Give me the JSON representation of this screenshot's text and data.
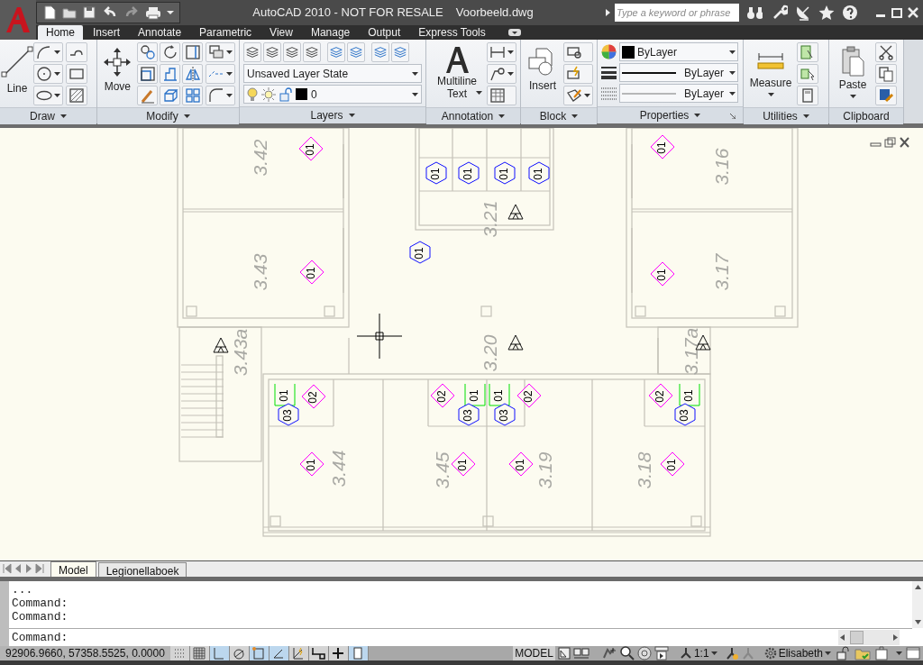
{
  "title_bar": {
    "title": "AutoCAD 2010 - NOT FOR RESALE",
    "document": "Voorbeeld.dwg",
    "search": {
      "placeholder": "Type a keyword or phrase"
    }
  },
  "ribbon_tabs": [
    {
      "label": "Home",
      "selected": true
    },
    {
      "label": "Insert",
      "selected": false
    },
    {
      "label": "Annotate",
      "selected": false
    },
    {
      "label": "Parametric",
      "selected": false
    },
    {
      "label": "View",
      "selected": false
    },
    {
      "label": "Manage",
      "selected": false
    },
    {
      "label": "Output",
      "selected": false
    },
    {
      "label": "Express Tools",
      "selected": false
    }
  ],
  "ribbon_panels": {
    "draw": {
      "title": "Draw",
      "big_button": "Line"
    },
    "modify": {
      "title": "Modify",
      "big_button": "Move"
    },
    "layers": {
      "title": "Layers",
      "layer_state": "Unsaved Layer State",
      "current_layer": "0"
    },
    "annotation": {
      "title": "Annotation",
      "big_button": [
        "Multiline",
        "Text"
      ]
    },
    "block": {
      "title": "Block",
      "big_button": "Insert"
    },
    "properties": {
      "title": "Properties",
      "color_setting": "ByLayer",
      "linetype": "ByLayer",
      "lineweight": "ByLayer"
    },
    "utilities": {
      "title": "Utilities",
      "big_button": "Measure"
    },
    "clipboard": {
      "title": "Clipboard",
      "big_button": "Paste"
    }
  },
  "drawing": {
    "rooms": [
      "3.42",
      "3.16",
      "3.21",
      "3.43",
      "3.17",
      "3.43a",
      "3.20",
      "3.17a",
      "3.44",
      "3.45",
      "3.19",
      "3.18"
    ],
    "tags": [
      {
        "kind": "diamond",
        "text": "01"
      },
      {
        "kind": "diamond",
        "text": "01"
      },
      {
        "kind": "diamond",
        "text": "01"
      },
      {
        "kind": "diamond",
        "text": "01"
      },
      {
        "kind": "hexagon",
        "text": "01"
      },
      {
        "kind": "hexagon",
        "text": "01"
      },
      {
        "kind": "hexagon",
        "text": "01"
      },
      {
        "kind": "hexagon",
        "text": "01"
      },
      {
        "kind": "hexagon",
        "text": "01"
      },
      {
        "kind": "square",
        "text": "01"
      },
      {
        "kind": "diamond",
        "text": "02"
      },
      {
        "kind": "hexagon",
        "text": "03"
      },
      {
        "kind": "diamond",
        "text": "02"
      },
      {
        "kind": "square",
        "text": "01"
      },
      {
        "kind": "hexagon",
        "text": "03"
      },
      {
        "kind": "square",
        "text": "01"
      },
      {
        "kind": "diamond",
        "text": "02"
      },
      {
        "kind": "hexagon",
        "text": "03"
      },
      {
        "kind": "diamond",
        "text": "02"
      },
      {
        "kind": "square",
        "text": "01"
      },
      {
        "kind": "hexagon",
        "text": "03"
      },
      {
        "kind": "diamond",
        "text": "01"
      },
      {
        "kind": "diamond",
        "text": "01"
      },
      {
        "kind": "diamond",
        "text": "01"
      },
      {
        "kind": "diamond",
        "text": "01"
      }
    ]
  },
  "layout_tabs": [
    {
      "label": "Model",
      "selected": true
    },
    {
      "label": "Legionellaboek",
      "selected": false
    }
  ],
  "command_history": [
    "...",
    "Command:",
    "Command:"
  ],
  "command_prompt": "Command:",
  "status_bar": {
    "coordinates": "92906.9660, 57358.5525, 0.0000",
    "toggles": [
      {
        "on": false
      },
      {
        "on": false
      },
      {
        "on": true
      },
      {
        "on": false
      },
      {
        "on": true
      },
      {
        "on": true
      },
      {
        "on": false
      },
      {
        "on": false
      },
      {
        "on": false
      },
      {
        "on": true
      }
    ],
    "space": "MODEL",
    "annotation_scale": "1:1",
    "workspace": "Elisabeth"
  }
}
